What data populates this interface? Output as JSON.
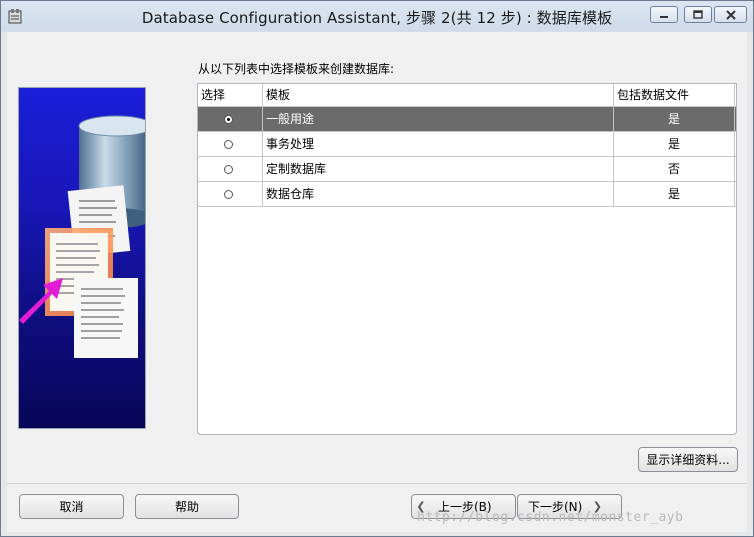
{
  "window": {
    "title": "Database Configuration Assistant, 步骤 2(共 12 步) : 数据库模板"
  },
  "instruction": "从以下列表中选择模板来创建数据库:",
  "table": {
    "headers": [
      "选择",
      "模板",
      "包括数据文件"
    ],
    "rows": [
      {
        "template": "一般用途",
        "includes": "是",
        "selected": true
      },
      {
        "template": "事务处理",
        "includes": "是",
        "selected": false
      },
      {
        "template": "定制数据库",
        "includes": "否",
        "selected": false
      },
      {
        "template": "数据仓库",
        "includes": "是",
        "selected": false
      }
    ]
  },
  "buttons": {
    "details": "显示详细资料...",
    "cancel": "取消",
    "help": "帮助",
    "back": "上一步(B)",
    "next": "下一步(N)"
  },
  "watermark": "http://blog.csdn.net/monster_ayb",
  "colors": {
    "selected_row": "#6b6b6b",
    "banner_top": "#1b1ed8",
    "banner_bottom": "#070658"
  }
}
